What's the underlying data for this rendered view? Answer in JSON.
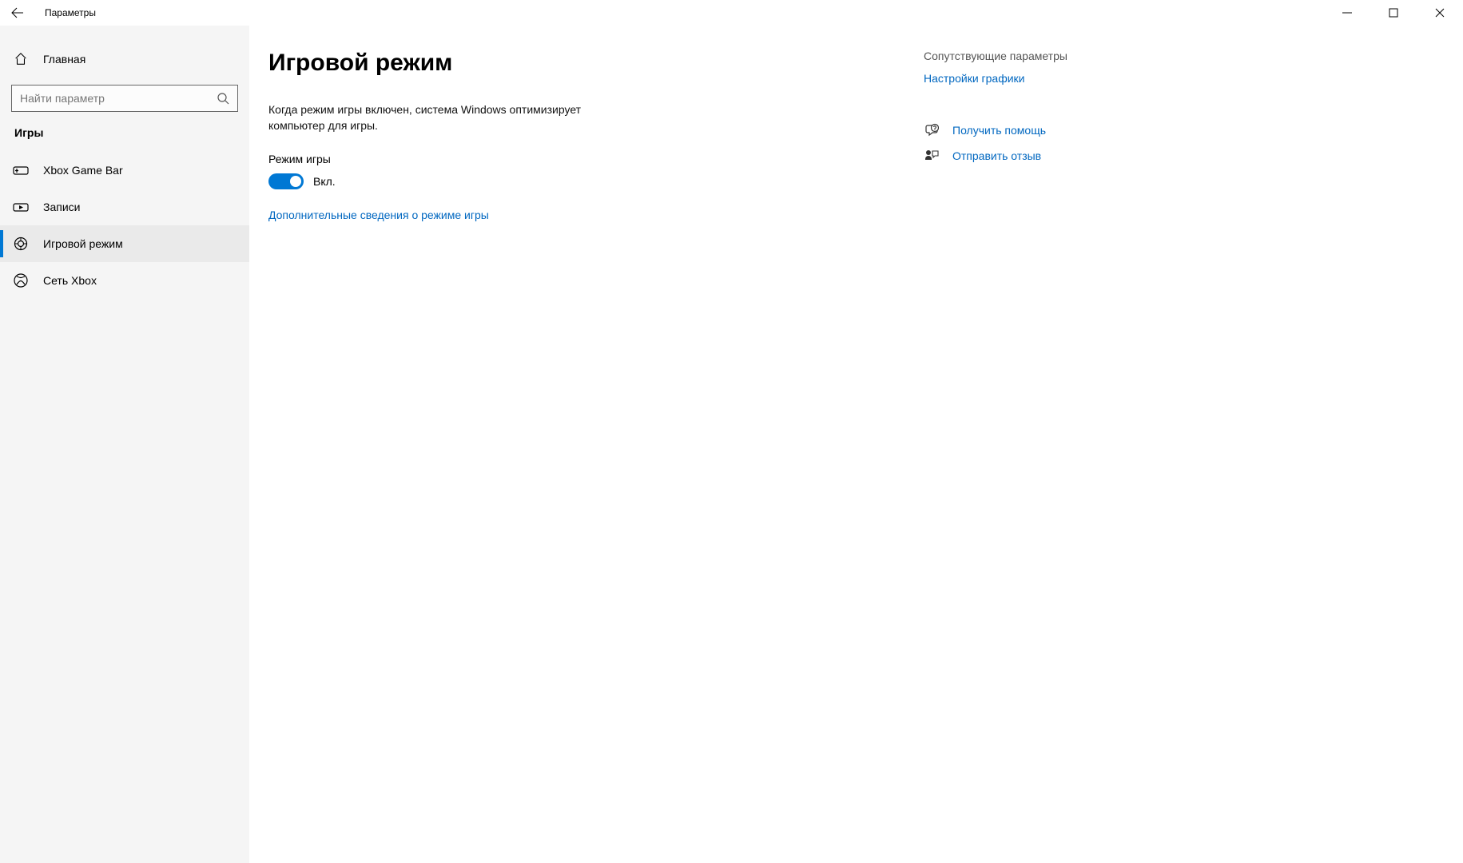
{
  "window": {
    "title": "Параметры"
  },
  "sidebar": {
    "home_label": "Главная",
    "search_placeholder": "Найти параметр",
    "category": "Игры",
    "items": [
      {
        "label": "Xbox Game Bar"
      },
      {
        "label": "Записи"
      },
      {
        "label": "Игровой режим"
      },
      {
        "label": "Сеть Xbox"
      }
    ]
  },
  "main": {
    "title": "Игровой режим",
    "description": "Когда режим игры включен, система Windows оптимизирует компьютер для игры.",
    "toggle_label": "Режим игры",
    "toggle_state": "Вкл.",
    "learn_more_link": "Дополнительные сведения о режиме игры"
  },
  "related": {
    "header": "Сопутствующие параметры",
    "graphics_link": "Настройки графики",
    "help_link": "Получить помощь",
    "feedback_link": "Отправить отзыв"
  }
}
